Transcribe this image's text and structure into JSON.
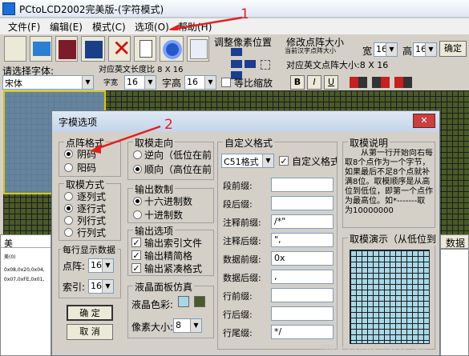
{
  "window": {
    "title": "PCtoLCD2002完美版-(字符模式)"
  },
  "menu": [
    "文件(F)",
    "编辑(E)",
    "模式(C)",
    "选项(O)",
    "帮助(H)"
  ],
  "toolbar": {
    "font_label": "请选择字体:",
    "font_value": "宋体",
    "font_size_info": "对应英文长度比 8 X 16",
    "char_width_label": "字宽",
    "char_width_value": "16",
    "char_height_label": "字高",
    "char_height_value": "16",
    "proportional_label": "等比缩放",
    "bold_label": "B",
    "italic_label": "I",
    "underline_label": "U",
    "adjust_pixel_label": "调整像素位置",
    "modify_size_label": "修改点阵大小",
    "current_size_label": "当前汉字点阵大小",
    "width_label": "宽",
    "width_value": "16",
    "height_label": "高",
    "height_value": "16",
    "confirm_label": "确定",
    "english_size_label": "对应英文点阵大小:8 X 16"
  },
  "left_panel": {
    "header": "美",
    "code1": "美(0)",
    "code2": "0x08,0x20,0x04,",
    "code3": "0x07,0xFE,0x01,"
  },
  "right_tab": "数据",
  "annotations": {
    "mark1": "1",
    "mark2": "2"
  },
  "dialog": {
    "title": "字模选项",
    "dot_format": {
      "title": "点阵格式",
      "options": [
        "阴码",
        "阳码"
      ],
      "selected": 0
    },
    "mode": {
      "title": "取模方式",
      "options": [
        "逐列式",
        "逐行式",
        "列行式",
        "行列式"
      ],
      "selected": 1
    },
    "per_line": {
      "title": "每行显示数据",
      "dot_label": "点阵:",
      "dot_value": "16",
      "index_label": "索引:",
      "index_value": "16"
    },
    "direction": {
      "title": "取模走向",
      "options": [
        "逆向（低位在前",
        "顺向（高位在前"
      ],
      "selected": 1
    },
    "output_base": {
      "title": "输出数制",
      "options": [
        "十六进制数",
        "十进制数"
      ],
      "selected": 0
    },
    "output_options": {
      "title": "输出选项",
      "options": [
        "输出索引文件",
        "输出精简格",
        "输出紧凑格式"
      ]
    },
    "lcd": {
      "title": "液晶面板仿真",
      "color_label": "液晶色彩:",
      "pixel_label": "像素大小:",
      "pixel_value": "8",
      "colors": [
        "#a8d8e8",
        "#4b5a2a"
      ]
    },
    "custom": {
      "title": "自定义格式",
      "format_value": "C51格式",
      "custom_check": "自定义格式",
      "rows": [
        {
          "label": "段前缀:",
          "value": ""
        },
        {
          "label": "段后缀:",
          "value": ""
        },
        {
          "label": "注释前缀:",
          "value": "/*\""
        },
        {
          "label": "注释后缀:",
          "value": "\","
        },
        {
          "label": "数据前缀:",
          "value": "0x"
        },
        {
          "label": "数据后缀:",
          "value": ","
        },
        {
          "label": "行前缀:",
          "value": ""
        },
        {
          "label": "行后缀:",
          "value": ""
        },
        {
          "label": "行尾缀:",
          "value": "*/"
        }
      ]
    },
    "desc": {
      "title": "取模说明",
      "text": "从第一行开始向右每取8个点作为一个字节，如果最后不足8个点就补满8位。取模顺序是从高位到低位，即第一个点作为最高位。如*-------取为10000000"
    },
    "demo": {
      "title": "取模演示（从低位到"
    },
    "ok_label": "确 定",
    "cancel_label": "取 消"
  },
  "watermark": "https://blog.csdn.net/qq_41..."
}
